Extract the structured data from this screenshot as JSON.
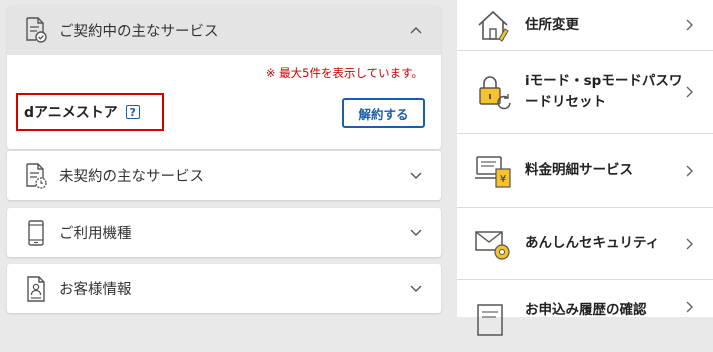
{
  "contracted": {
    "title": "ご契約中の主なサービス",
    "note": "※ 最大5件を表示しています。",
    "service_name": "dアニメストア",
    "help_label": "?",
    "cancel_label": "解約する"
  },
  "left_items": [
    {
      "title": "未契約の主なサービス"
    },
    {
      "title": "ご利用機種"
    },
    {
      "title": "お客様情報"
    }
  ],
  "right_items": [
    {
      "label": "住所変更"
    },
    {
      "label": "iモード・spモードパスワードリセット"
    },
    {
      "label": "料金明細サービス"
    },
    {
      "label": "あんしんセキュリティ"
    },
    {
      "label": "お申込み履歴の確認"
    }
  ],
  "colors": {
    "accent": "#1b5faa",
    "alert": "#cc0000",
    "highlight_border": "#d40000",
    "icon_yellow": "#f6c32a"
  }
}
